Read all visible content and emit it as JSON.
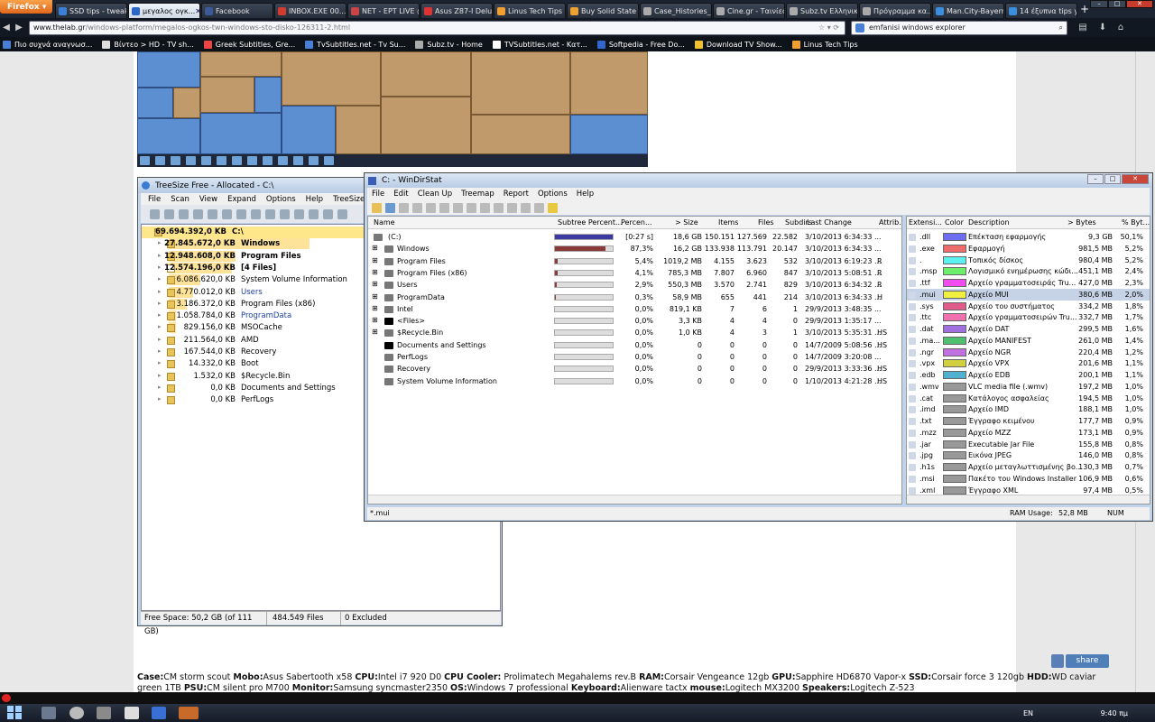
{
  "browser": {
    "menu_label": "Firefox",
    "tabs": [
      {
        "label": "SSD tips - tweak...",
        "color": "#3b7fd6"
      },
      {
        "label": "μεγαλος ογκ...",
        "color": "#2a66c6",
        "active": true
      },
      {
        "label": "Facebook",
        "color": "#3b5998"
      },
      {
        "label": "INBOX.EXE 00...",
        "color": "#d43b2f"
      },
      {
        "label": "NET - ΕΡΤ LIVE @...",
        "color": "#c44"
      },
      {
        "label": "Asus Z87-I Delux...",
        "color": "#d33"
      },
      {
        "label": "Linus Tech Tips",
        "color": "#f0a030"
      },
      {
        "label": "Buy Solid State ...",
        "color": "#f0a030"
      },
      {
        "label": "Case_Histories_...",
        "color": "#aaa"
      },
      {
        "label": "Cine.gr - Ταινίες ...",
        "color": "#aaa"
      },
      {
        "label": "Subz.tv Ελληνικ...",
        "color": "#aaa"
      },
      {
        "label": "Πρόγραμμα κα...",
        "color": "#aaa"
      },
      {
        "label": "Man.City-Bayern...",
        "color": "#3b8ede"
      },
      {
        "label": "14 έξυπνα tips y...",
        "color": "#3b8ede"
      }
    ],
    "close_tab": "✕",
    "new_tab": "+",
    "url_host": "www.thelab.gr",
    "url_path": "/windows-platform/megalos-ogkos-twn-windows-sto-disko-126311-2.html",
    "search_value": "emfanisi windows explorer",
    "bookmarks": [
      {
        "label": "Πιο συχνά αναγνωσ...",
        "color": "#4a7fd6"
      },
      {
        "label": "Βίντεο > HD - TV sh...",
        "color": "#ddd"
      },
      {
        "label": "Greek Subtitles, Gre...",
        "color": "#e44"
      },
      {
        "label": "TvSubtitles.net - Tv Su...",
        "color": "#4a7fd6"
      },
      {
        "label": "Subz.tv - Home",
        "color": "#aaa"
      },
      {
        "label": "TVSubtitles.net - Κατ...",
        "color": "#fff"
      },
      {
        "label": "Softpedia - Free Do...",
        "color": "#3366cc"
      },
      {
        "label": "Download TV Show...",
        "color": "#f0c030"
      },
      {
        "label": "Linus Tech Tips",
        "color": "#f0a030"
      }
    ]
  },
  "treesize": {
    "title": "TreeSize Free - Allocated - C:\\",
    "menu": [
      "File",
      "Scan",
      "View",
      "Expand",
      "Options",
      "Help",
      "TreeSize Professional"
    ],
    "rows": [
      {
        "size": "69.694.392,0 KB",
        "name": "C:\\",
        "bold": true,
        "bar": 1.0,
        "root": true
      },
      {
        "size": "27.845.672,0 KB",
        "name": "Windows",
        "bold": true,
        "bar": 0.4
      },
      {
        "size": "12.948.608,0 KB",
        "name": "Program Files",
        "bold": true,
        "bar": 0.19
      },
      {
        "size": "12.574.196,0 KB",
        "name": "[4 Files]",
        "bold": true,
        "bar": 0.18,
        "file": true
      },
      {
        "size": "6.086.620,0 KB",
        "name": "System Volume Information",
        "bar": 0.09
      },
      {
        "size": "4.770.012,0 KB",
        "name": "Users",
        "bar": 0.07,
        "blue": true
      },
      {
        "size": "3.186.372,0 KB",
        "name": "Program Files (x86)",
        "bar": 0.05
      },
      {
        "size": "1.058.784,0 KB",
        "name": "ProgramData",
        "bar": 0.02,
        "blue": true
      },
      {
        "size": "829.156,0 KB",
        "name": "MSOCache",
        "bar": 0.01
      },
      {
        "size": "211.564,0 KB",
        "name": "AMD",
        "bar": 0.0
      },
      {
        "size": "167.544,0 KB",
        "name": "Recovery",
        "bar": 0.0
      },
      {
        "size": "14.332,0 KB",
        "name": "Boot",
        "bar": 0.0
      },
      {
        "size": "1.532,0 KB",
        "name": "$Recycle.Bin",
        "bar": 0.0
      },
      {
        "size": "0,0 KB",
        "name": "Documents and Settings",
        "bar": 0.0,
        "link": true
      },
      {
        "size": "0,0 KB",
        "name": "PerfLogs",
        "bar": 0.0
      }
    ],
    "status": {
      "free": "Free Space: 50,2 GB  (of 111 GB)",
      "files": "484.549  Files",
      "excluded": "0 Excluded"
    }
  },
  "windirstat": {
    "title": "C: - WinDirStat",
    "menu": [
      "File",
      "Edit",
      "Clean Up",
      "Treemap",
      "Report",
      "Options",
      "Help"
    ],
    "columns": [
      "Name",
      "Subtree Percent...",
      "Percen...",
      "> Size",
      "Items",
      "Files",
      "Subdirs",
      "Last Change",
      "Attrib..."
    ],
    "rows": [
      {
        "name": "(C:)",
        "sub": 1.0,
        "pct": "[0:27 s]",
        "size": "18,6 GB",
        "items": "150.151",
        "files": "127.569",
        "subdirs": "22.582",
        "last": "3/10/2013 6:34:33 ...",
        "attr": "",
        "root": true
      },
      {
        "name": "Windows",
        "sub": 0.873,
        "pct": "87,3%",
        "size": "16,2 GB",
        "items": "133.938",
        "files": "113.791",
        "subdirs": "20.147",
        "last": "3/10/2013 6:34:33 ...",
        "attr": "",
        "exp": true
      },
      {
        "name": "Program Files",
        "sub": 0.054,
        "pct": "5,4%",
        "size": "1019,2 MB",
        "items": "4.155",
        "files": "3.623",
        "subdirs": "532",
        "last": "3/10/2013 6:19:23 ...",
        "attr": "R",
        "exp": true
      },
      {
        "name": "Program Files (x86)",
        "sub": 0.041,
        "pct": "4,1%",
        "size": "785,3 MB",
        "items": "7.807",
        "files": "6.960",
        "subdirs": "847",
        "last": "3/10/2013 5:08:51 ...",
        "attr": "R",
        "exp": true
      },
      {
        "name": "Users",
        "sub": 0.029,
        "pct": "2,9%",
        "size": "550,3 MB",
        "items": "3.570",
        "files": "2.741",
        "subdirs": "829",
        "last": "3/10/2013 6:34:32 ...",
        "attr": "R",
        "exp": true
      },
      {
        "name": "ProgramData",
        "sub": 0.003,
        "pct": "0,3%",
        "size": "58,9 MB",
        "items": "655",
        "files": "441",
        "subdirs": "214",
        "last": "3/10/2013 6:34:33 ...",
        "attr": "H",
        "exp": true
      },
      {
        "name": "Intel",
        "sub": 0.0,
        "pct": "0,0%",
        "size": "819,1 KB",
        "items": "7",
        "files": "6",
        "subdirs": "1",
        "last": "29/9/2013 3:48:35 ...",
        "attr": "",
        "exp": true
      },
      {
        "name": "<Files>",
        "sub": 0.0,
        "pct": "0,0%",
        "size": "3,3 KB",
        "items": "4",
        "files": "4",
        "subdirs": "0",
        "last": "29/9/2013 1:35:17 ...",
        "attr": "",
        "exp": true,
        "black": true
      },
      {
        "name": "$Recycle.Bin",
        "sub": 0.0,
        "pct": "0,0%",
        "size": "1,0 KB",
        "items": "4",
        "files": "3",
        "subdirs": "1",
        "last": "3/10/2013 5:35:31 ...",
        "attr": "HS",
        "exp": true
      },
      {
        "name": "Documents and Settings",
        "sub": 0.0,
        "pct": "0,0%",
        "size": "0",
        "items": "0",
        "files": "0",
        "subdirs": "0",
        "last": "14/7/2009 5:08:56 ...",
        "attr": "HS",
        "black": true
      },
      {
        "name": "PerfLogs",
        "sub": 0.0,
        "pct": "0,0%",
        "size": "0",
        "items": "0",
        "files": "0",
        "subdirs": "0",
        "last": "14/7/2009 3:20:08 ...",
        "attr": ""
      },
      {
        "name": "Recovery",
        "sub": 0.0,
        "pct": "0,0%",
        "size": "0",
        "items": "0",
        "files": "0",
        "subdirs": "0",
        "last": "29/9/2013 3:33:36 ...",
        "attr": "HS"
      },
      {
        "name": "System Volume Information",
        "sub": 0.0,
        "pct": "0,0%",
        "size": "0",
        "items": "0",
        "files": "0",
        "subdirs": "0",
        "last": "1/10/2013 4:21:28 ...",
        "attr": "HS"
      }
    ],
    "ext_columns": [
      "Extensi...",
      "Color",
      "Description",
      "> Bytes",
      "% Byt..."
    ],
    "extensions": [
      {
        "ext": ".dll",
        "color": "#6e6ef0",
        "desc": "Επέκταση εφαρμογής",
        "bytes": "9,3 GB",
        "pct": "50,1%"
      },
      {
        "ext": ".exe",
        "color": "#ef6c6c",
        "desc": "Εφαρμογή",
        "bytes": "981,5 MB",
        "pct": "5,2%"
      },
      {
        "ext": ".",
        "color": "#5cf0f0",
        "desc": "Τοπικός δίσκος",
        "bytes": "980,4 MB",
        "pct": "5,2%"
      },
      {
        "ext": ".msp",
        "color": "#6cf06c",
        "desc": "Λογισμικό ενημέρωσης κώδι...",
        "bytes": "451,1 MB",
        "pct": "2,4%"
      },
      {
        "ext": ".ttf",
        "color": "#f04cf0",
        "desc": "Αρχείο γραμματοσειράς Tru...",
        "bytes": "427,0 MB",
        "pct": "2,3%"
      },
      {
        "ext": ".mui",
        "color": "#f0f040",
        "desc": "Αρχείο MUI",
        "bytes": "380,6 MB",
        "pct": "2,0%",
        "sel": true
      },
      {
        "ext": ".sys",
        "color": "#e05a8a",
        "desc": "Αρχείο του συστήματος",
        "bytes": "334,2 MB",
        "pct": "1,8%"
      },
      {
        "ext": ".ttc",
        "color": "#f070b0",
        "desc": "Αρχείο γραμματοσειρών Tru...",
        "bytes": "332,7 MB",
        "pct": "1,7%"
      },
      {
        "ext": ".dat",
        "color": "#a070e0",
        "desc": "Αρχείο DAT",
        "bytes": "299,5 MB",
        "pct": "1,6%"
      },
      {
        "ext": ".ma...",
        "color": "#50c070",
        "desc": "Αρχείο MANIFEST",
        "bytes": "261,0 MB",
        "pct": "1,4%"
      },
      {
        "ext": ".ngr",
        "color": "#c070e0",
        "desc": "Αρχείο NGR",
        "bytes": "220,4 MB",
        "pct": "1,2%"
      },
      {
        "ext": ".vpx",
        "color": "#d0d040",
        "desc": "Αρχείο VPX",
        "bytes": "201,6 MB",
        "pct": "1,1%"
      },
      {
        "ext": ".edb",
        "color": "#50b0d0",
        "desc": "Αρχείο EDB",
        "bytes": "200,1 MB",
        "pct": "1,1%"
      },
      {
        "ext": ".wmv",
        "color": "#999999",
        "desc": "VLC media file (.wmv)",
        "bytes": "197,2 MB",
        "pct": "1,0%"
      },
      {
        "ext": ".cat",
        "color": "#999999",
        "desc": "Κατάλογος ασφαλείας",
        "bytes": "194,5 MB",
        "pct": "1,0%"
      },
      {
        "ext": ".imd",
        "color": "#999999",
        "desc": "Αρχείο IMD",
        "bytes": "188,1 MB",
        "pct": "1,0%"
      },
      {
        "ext": ".txt",
        "color": "#999999",
        "desc": "Έγγραφο κειμένου",
        "bytes": "177,7 MB",
        "pct": "0,9%"
      },
      {
        "ext": ".mzz",
        "color": "#999999",
        "desc": "Αρχείο MZZ",
        "bytes": "173,1 MB",
        "pct": "0,9%"
      },
      {
        "ext": ".jar",
        "color": "#999999",
        "desc": "Executable Jar File",
        "bytes": "155,8 MB",
        "pct": "0,8%"
      },
      {
        "ext": ".jpg",
        "color": "#999999",
        "desc": "Εικόνα JPEG",
        "bytes": "146,0 MB",
        "pct": "0,8%"
      },
      {
        "ext": ".h1s",
        "color": "#999999",
        "desc": "Αρχείο μεταγλωττισμένης βο...",
        "bytes": "130,3 MB",
        "pct": "0,7%"
      },
      {
        "ext": ".msi",
        "color": "#999999",
        "desc": "Πακέτο του Windows Installer",
        "bytes": "106,9 MB",
        "pct": "0,6%"
      },
      {
        "ext": ".xml",
        "color": "#999999",
        "desc": "Έγγραφο XML",
        "bytes": "97,4 MB",
        "pct": "0,5%"
      }
    ],
    "status": {
      "path": "*.mui",
      "ram_label": "RAM Usage:",
      "ram_value": "52,8 MB",
      "num": "NUM"
    }
  },
  "page": {
    "share_label": "share",
    "specs": [
      {
        "k": "Case:",
        "v": "CM storm scout "
      },
      {
        "k": "Mobo:",
        "v": "Asus Sabertooth x58 "
      },
      {
        "k": "CPU:",
        "v": "Intel i7 920 D0 "
      },
      {
        "k": "CPU Cooler:",
        "v": " Prolimatech Megahalems rev.B "
      },
      {
        "k": "RAM:",
        "v": "Corsair Vengeance 12gb "
      },
      {
        "k": "GPU:",
        "v": "Sapphire HD6870 Vapor-x "
      },
      {
        "k": "SSD:",
        "v": "Corsair force 3 120gb "
      },
      {
        "k": "HDD:",
        "v": "WD caviar green 1TB "
      },
      {
        "k": "PSU:",
        "v": "CM silent pro M700 "
      },
      {
        "k": "Monitor:",
        "v": "Samsung syncmaster2350 "
      },
      {
        "k": "OS:",
        "v": "Windows 7 professional "
      },
      {
        "k": "Keyboard:",
        "v": "Alienware tactx "
      },
      {
        "k": "mouse:",
        "v": "Logitech MX3200 "
      },
      {
        "k": "Speakers:",
        "v": "Logitech Z-523"
      }
    ]
  },
  "taskbar": {
    "lang": "EN",
    "clock": "9:40 πμ"
  }
}
